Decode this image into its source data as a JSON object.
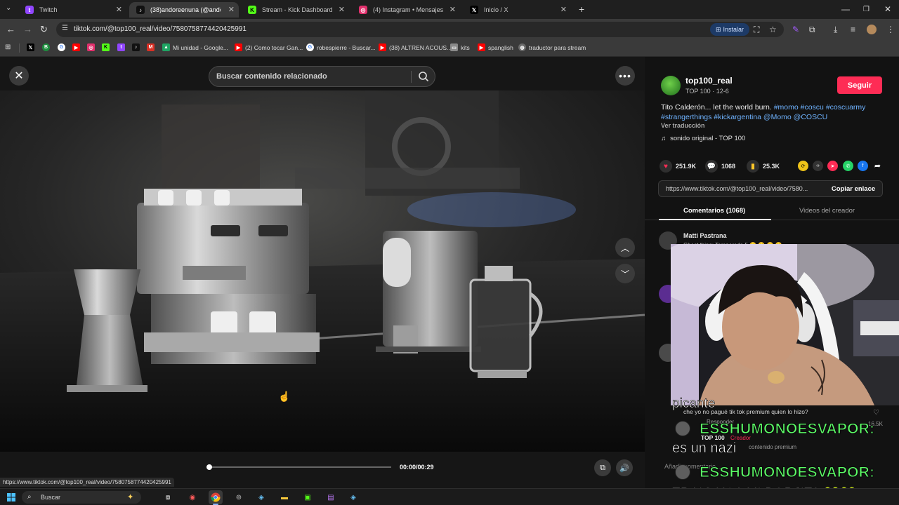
{
  "browser": {
    "tabs": [
      {
        "label": "Twitch",
        "color": "#9146ff",
        "icon": "twitch-icon"
      },
      {
        "label": "(38)andoreenuna (@andore",
        "color": "#000000",
        "icon": "tiktok-icon"
      },
      {
        "label": "Stream - Kick Dashboard",
        "color": "#53fc18",
        "icon": "kick-icon"
      },
      {
        "label": "(4) Instagram • Mensajes",
        "color": "#e1306c",
        "icon": "instagram-icon"
      },
      {
        "label": "Inicio / X",
        "color": "#000000",
        "icon": "x-icon"
      }
    ],
    "new_tab": "+",
    "url": "tiktok.com/@top100_real/video/7580758774420425991",
    "install_label": "Instalar",
    "bookmarks": [
      {
        "label": "",
        "icon": "x-icon",
        "color": "#000000"
      },
      {
        "label": "",
        "icon": "sheets-icon",
        "color": "#1e8e3e"
      },
      {
        "label": "",
        "icon": "google-icon",
        "color": "#4285f4"
      },
      {
        "label": "",
        "icon": "youtube-icon",
        "color": "#ff0000"
      },
      {
        "label": "",
        "icon": "instagram-icon",
        "color": "#e1306c"
      },
      {
        "label": "",
        "icon": "kick-icon",
        "color": "#53fc18"
      },
      {
        "label": "",
        "icon": "twitch-icon",
        "color": "#9146ff"
      },
      {
        "label": "",
        "icon": "tiktok-icon",
        "color": "#111111"
      },
      {
        "label": "",
        "icon": "gmail-icon",
        "color": "#d93025"
      },
      {
        "label": "Mi unidad - Google...",
        "icon": "drive-icon",
        "color": "#1fa463"
      },
      {
        "label": "(2) Como tocar Gan...",
        "icon": "youtube-icon",
        "color": "#ff0000"
      },
      {
        "label": "robespierre - Buscar...",
        "icon": "google-icon",
        "color": "#4285f4"
      },
      {
        "label": "(38) ALTREN ACOUS...",
        "icon": "youtube-icon",
        "color": "#ff0000"
      },
      {
        "label": "kits",
        "icon": "folder-icon",
        "color": "#8a8a8a"
      },
      {
        "label": "spanglish",
        "icon": "youtube-icon",
        "color": "#ff0000"
      },
      {
        "label": "traductor para stream",
        "icon": "globe-icon",
        "color": "#6a6a6a"
      }
    ],
    "status_url": "https://www.tiktok.com/@top100_real/video/7580758774420425991"
  },
  "player": {
    "search_placeholder": "Buscar contenido relacionado",
    "time": "00:00/00:29",
    "progress": 0.0
  },
  "post": {
    "username": "top100_real",
    "subtitle": "TOP 100 · 12-6",
    "follow_label": "Seguir",
    "description_plain": "Tito Calderón... let the world burn. ",
    "description_tags": "#momo #coscu #coscuarmy #strangerthings #kickargentina @Momo @COSCU",
    "translate_label": "Ver traducción",
    "sound_label": "sonido original - TOP 100",
    "likes": "251.9K",
    "comments": "1068",
    "saves": "25.3K",
    "link": "https://www.tiktok.com/@top100_real/video/7580...",
    "copy_label": "Copiar enlace",
    "tab_comments": "Comentarios (1068)",
    "tab_creator": "Videos del creador"
  },
  "comments": [
    {
      "name": "Matti Pastrana",
      "text": "Ghost thing: Temporada 5 😮 😮 😮 😮"
    },
    {
      "text": "che yo no pagué tik tok premium quien lo hizo?",
      "reply": "Responder",
      "count": "16.5K"
    },
    {
      "name": "TOP 100",
      "badge": "Creador",
      "text": "contenido premium"
    }
  ],
  "comment_input_placeholder": "Añadir comentario...",
  "overlay_chat": [
    {
      "user": "ESSHUMONOESVAPOR:",
      "message": "es un nazi"
    },
    {
      "user": "ESSHUMONOESVAPOR:",
      "message": "TRAIGAN A MI BORJITA 🐸🐸"
    }
  ],
  "overlay_top_text": "picante",
  "taskbar": {
    "search_label": "Buscar"
  },
  "colors": {
    "accent": "#fe2c55",
    "link": "#6fb3ff",
    "chat_name": "#5cff67"
  }
}
